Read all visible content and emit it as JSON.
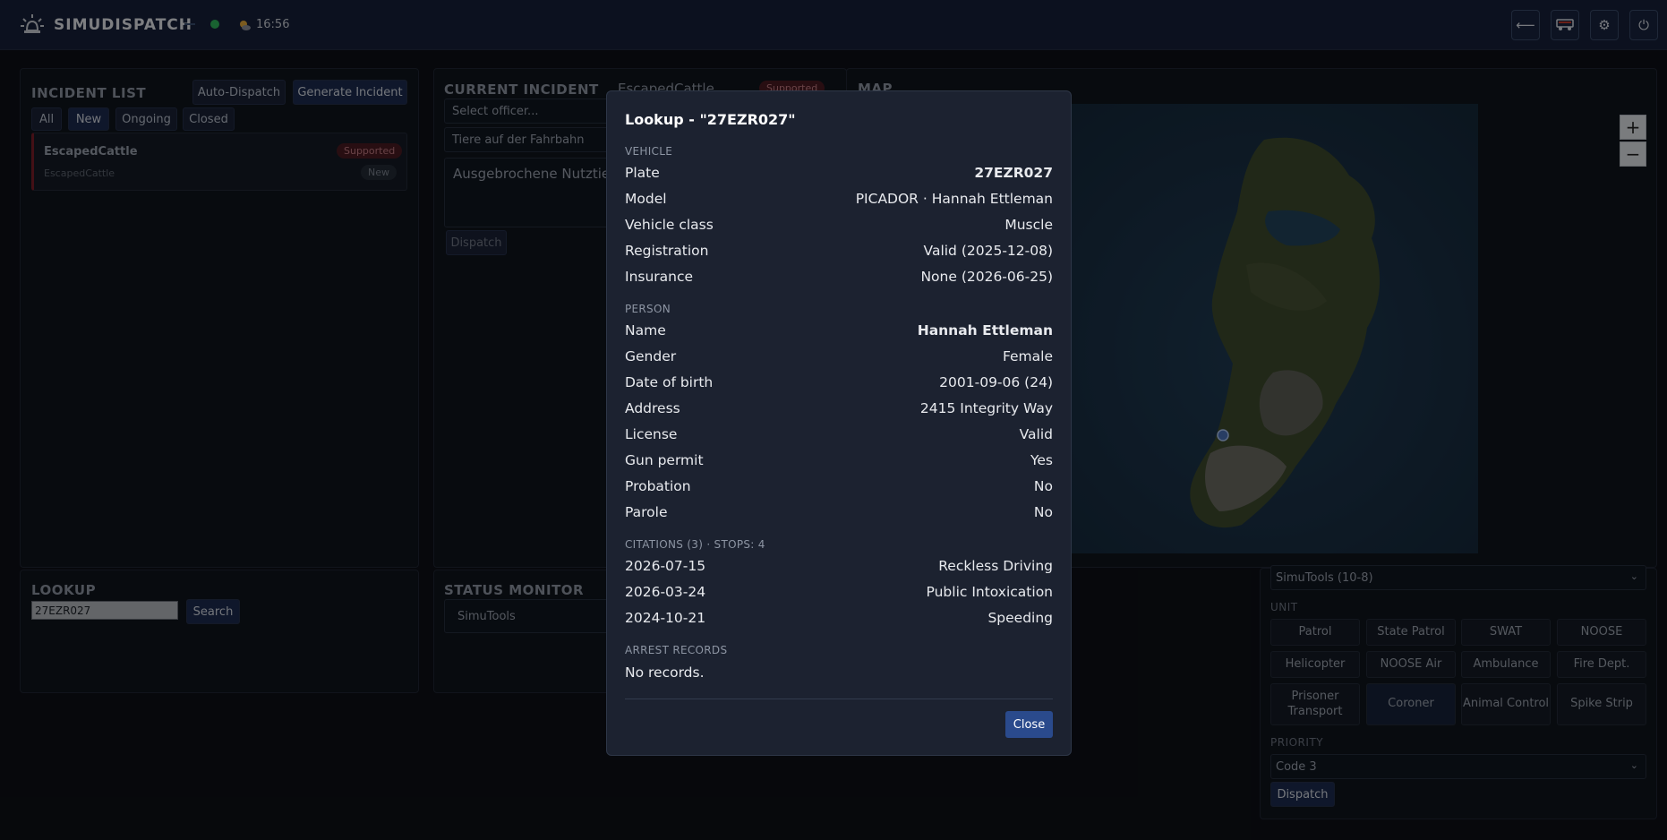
{
  "header": {
    "app_name": "SIMUDISPATCH",
    "clock": "16:56",
    "buttons": [
      {
        "icon": "arrow-left-icon",
        "glyph": "⟵"
      },
      {
        "icon": "vehicle-icon",
        "glyph": "▭"
      },
      {
        "icon": "gear-icon",
        "glyph": "⚙"
      },
      {
        "icon": "power-icon",
        "glyph": "⏻"
      }
    ]
  },
  "incident_list": {
    "title": "INCIDENT LIST",
    "auto_dispatch": "Auto-Dispatch",
    "generate": "Generate Incident",
    "tabs": [
      "All",
      "New",
      "Ongoing",
      "Closed"
    ],
    "items": [
      {
        "name": "EscapedCattle",
        "sub": "EscapedCattle",
        "badge": "Supported",
        "status": "New"
      }
    ]
  },
  "current_incident": {
    "title": "CURRENT INCIDENT",
    "name": "EscapedCattle",
    "badge": "Supported",
    "officer_placeholder": "Select officer...",
    "field1": "Tiere auf der Fahrbahn",
    "description": "Ausgebrochene Nutztier",
    "dispatch": "Dispatch"
  },
  "map": {
    "title": "MAP",
    "zoom_in": "+",
    "zoom_out": "−"
  },
  "lookup": {
    "title": "LOOKUP",
    "value": "27EZR027",
    "search": "Search"
  },
  "status_monitor": {
    "title": "STATUS MONITOR",
    "unit": "SimuTools"
  },
  "dispatch_panel": {
    "source": "SimuTools (10-8)",
    "unit_label": "UNIT",
    "units": [
      "Patrol",
      "State Patrol",
      "SWAT",
      "NOOSE",
      "Helicopter",
      "NOOSE Air",
      "Ambulance",
      "Fire Dept.",
      "Prisoner Transport",
      "Coroner",
      "Animal Control",
      "Spike Strip"
    ],
    "priority_label": "PRIORITY",
    "priority": "Code 3",
    "dispatch": "Dispatch"
  },
  "modal": {
    "title": "Lookup - \"27EZR027\"",
    "vehicle_label": "VEHICLE",
    "vehicle": [
      {
        "k": "Plate",
        "v": "27EZR027"
      },
      {
        "k": "Model",
        "v": "PICADOR · Hannah Ettleman"
      },
      {
        "k": "Vehicle class",
        "v": "Muscle"
      },
      {
        "k": "Registration",
        "v": "Valid (2025-12-08)"
      },
      {
        "k": "Insurance",
        "v": "None (2026-06-25)"
      }
    ],
    "person_label": "PERSON",
    "person": [
      {
        "k": "Name",
        "v": "Hannah Ettleman"
      },
      {
        "k": "Gender",
        "v": "Female"
      },
      {
        "k": "Date of birth",
        "v": "2001-09-06 (24)"
      },
      {
        "k": "Address",
        "v": "2415 Integrity Way"
      },
      {
        "k": "License",
        "v": "Valid"
      },
      {
        "k": "Gun permit",
        "v": "Yes"
      },
      {
        "k": "Probation",
        "v": "No"
      },
      {
        "k": "Parole",
        "v": "No"
      }
    ],
    "citations_label": "CITATIONS (3) · STOPS: 4",
    "citations": [
      {
        "k": "2026-07-15",
        "v": "Reckless Driving"
      },
      {
        "k": "2026-03-24",
        "v": "Public Intoxication"
      },
      {
        "k": "2024-10-21",
        "v": "Speeding"
      }
    ],
    "arrest_label": "ARREST RECORDS",
    "arrest_text": "No records.",
    "close": "Close"
  },
  "colors": {
    "accent": "#2a4a8c",
    "supported_badge": "#a3202c",
    "online": "#2fb35a"
  }
}
